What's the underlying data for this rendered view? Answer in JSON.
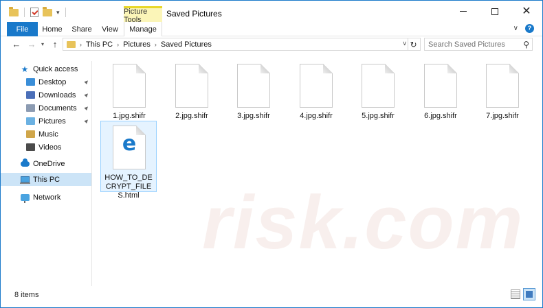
{
  "window": {
    "title": "Saved Pictures"
  },
  "ribbon": {
    "context_header": "Picture Tools",
    "tabs": [
      "File",
      "Home",
      "Share",
      "View",
      "Manage"
    ]
  },
  "address": {
    "crumbs": [
      "This PC",
      "Pictures",
      "Saved Pictures"
    ]
  },
  "search": {
    "placeholder": "Search Saved Pictures"
  },
  "sidebar": {
    "items": [
      {
        "label": "Quick access",
        "icon": "star-icon"
      },
      {
        "label": "Desktop",
        "icon": "desktop-folder-icon",
        "pinned": true
      },
      {
        "label": "Downloads",
        "icon": "downloads-folder-icon",
        "pinned": true
      },
      {
        "label": "Documents",
        "icon": "documents-folder-icon",
        "pinned": true
      },
      {
        "label": "Pictures",
        "icon": "pictures-folder-icon",
        "pinned": true
      },
      {
        "label": "Music",
        "icon": "music-folder-icon"
      },
      {
        "label": "Videos",
        "icon": "videos-folder-icon"
      },
      {
        "label": "OneDrive",
        "icon": "onedrive-cloud-icon"
      },
      {
        "label": "This PC",
        "icon": "computer-icon",
        "selected": true
      },
      {
        "label": "Network",
        "icon": "network-icon"
      }
    ]
  },
  "files": [
    {
      "name": "1.jpg.shifr",
      "icon": "blank-file-icon"
    },
    {
      "name": "2.jpg.shifr",
      "icon": "blank-file-icon"
    },
    {
      "name": "3.jpg.shifr",
      "icon": "blank-file-icon"
    },
    {
      "name": "4.jpg.shifr",
      "icon": "blank-file-icon"
    },
    {
      "name": "5.jpg.shifr",
      "icon": "blank-file-icon"
    },
    {
      "name": "6.jpg.shifr",
      "icon": "blank-file-icon"
    },
    {
      "name": "7.jpg.shifr",
      "icon": "blank-file-icon"
    },
    {
      "name": "HOW_TO_DECRYPT_FILES.html",
      "icon": "edge-html-file-icon",
      "selected": true
    }
  ],
  "status": {
    "item_count": "8 items"
  },
  "colors": {
    "accent": "#1979ca",
    "selection": "#cce4f7",
    "tools_highlight": "#fbf5b8"
  }
}
